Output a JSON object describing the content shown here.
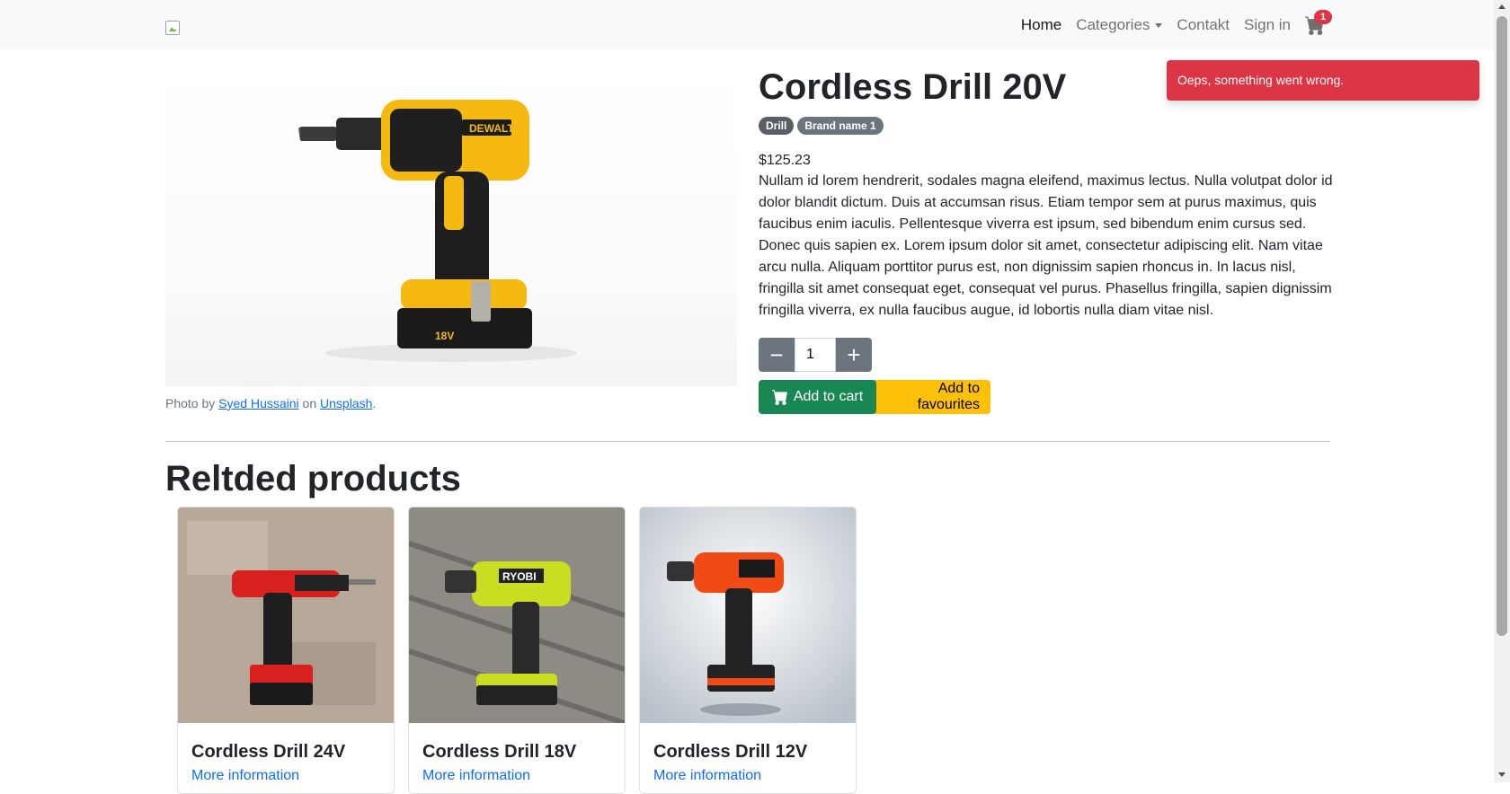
{
  "nav": {
    "home": "Home",
    "categories": "Categories",
    "contact": "Contakt",
    "signin": "Sign in",
    "cart_count": "1"
  },
  "product": {
    "title": "Cordless Drill 20V",
    "badges": [
      "Drill",
      "Brand name 1"
    ],
    "price": "$125.23",
    "description": "Nullam id lorem hendrerit, sodales magna eleifend, maximus lectus. Nulla volutpat dolor id dolor blandit dictum. Duis at accumsan risus. Etiam tempor sem at purus maximus, quis faucibus enim iaculis. Pellentesque viverra est ipsum, sed bibendum enim cursus sed. Donec quis sapien ex. Lorem ipsum dolor sit amet, consectetur adipiscing elit. Nam vitae arcu nulla. Aliquam porttitor purus est, non dignissim sapien rhoncus in. In lacus nisl, fringilla sit amet consequat eget, consequat vel purus. Phasellus fringilla, sapien dignissim fringilla viverra, ex nulla faucibus augue, id lobortis nulla diam vitae nisl.",
    "quantity": "1",
    "add_to_cart": "Add to cart",
    "add_to_favourites": "Add to favourites",
    "credit": {
      "prefix": "Photo by ",
      "author": "Syed Hussaini",
      "middle": " on ",
      "site": "Unsplash",
      "suffix": "."
    }
  },
  "toast": {
    "message": "Oeps, something went wrong."
  },
  "related": {
    "title": "Reltded products",
    "items": [
      {
        "name": "Cordless Drill 24V",
        "link": "More information",
        "accent": "#d8201f"
      },
      {
        "name": "Cordless Drill 18V",
        "link": "More information",
        "accent": "#c9de20"
      },
      {
        "name": "Cordless Drill 12V",
        "link": "More information",
        "accent": "#f04b14"
      }
    ]
  }
}
